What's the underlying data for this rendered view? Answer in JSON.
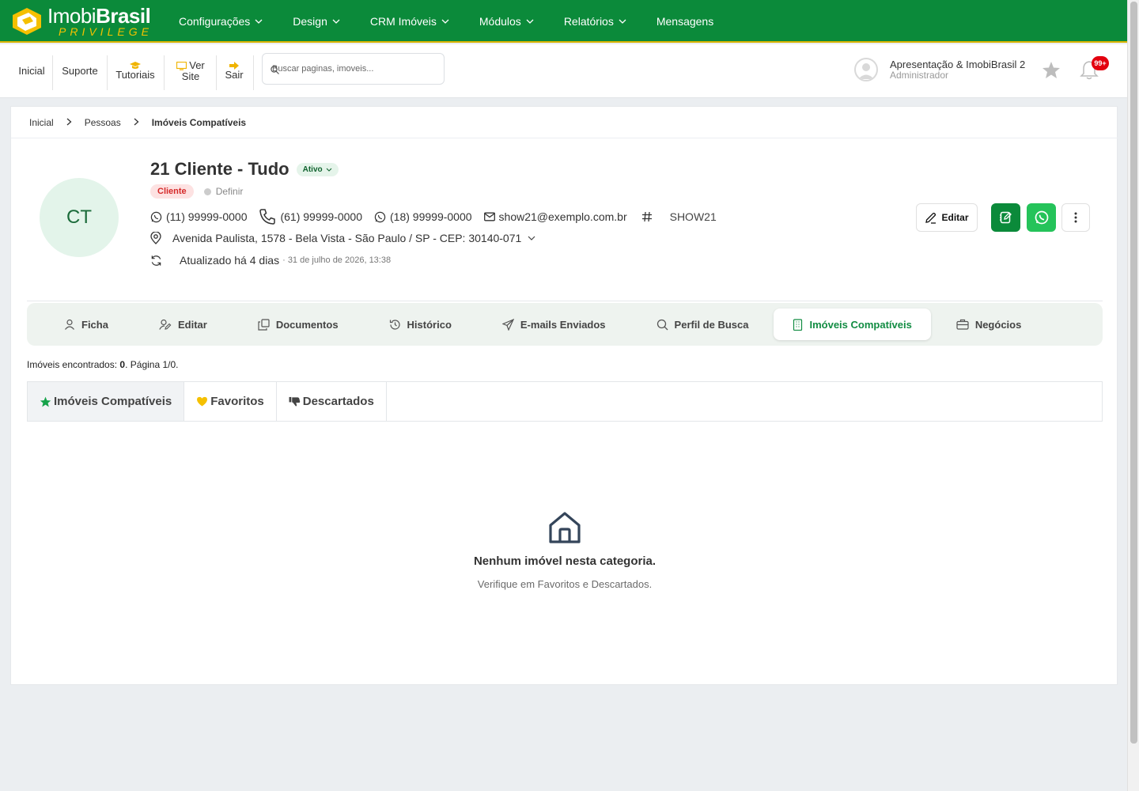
{
  "logo": {
    "brand_light": "Imobi",
    "brand_bold": "Brasil",
    "tagline": "PRIVILEGE"
  },
  "mainnav": [
    {
      "label": "Configurações",
      "dropdown": true
    },
    {
      "label": "Design",
      "dropdown": true
    },
    {
      "label": "CRM Imóveis",
      "dropdown": true
    },
    {
      "label": "Módulos",
      "dropdown": true
    },
    {
      "label": "Relatórios",
      "dropdown": true
    },
    {
      "label": "Mensagens",
      "dropdown": false
    }
  ],
  "toolbar": {
    "inicial": "Inicial",
    "suporte": "Suporte",
    "tutoriais": "Tutoriais",
    "ver_site_1": "Ver",
    "ver_site_2": "Site",
    "sair": "Sair",
    "search_placeholder": "Buscar paginas, imoveis..."
  },
  "user": {
    "name": "Apresentação & ImobiBrasil 2",
    "role": "Administrador",
    "notifications": "99+"
  },
  "breadcrumb": {
    "items": [
      "Inicial",
      "Pessoas"
    ],
    "current": "Imóveis Compatíveis"
  },
  "person": {
    "initials": "CT",
    "name": "21 Cliente - Tudo",
    "status": "Ativo",
    "type_tag": "Cliente",
    "define_label": "Definir",
    "phone_whatsapp_1": "(11) 99999-0000",
    "phone": "(61) 99999-0000",
    "phone_whatsapp_2": "(18) 99999-0000",
    "email": "show21@exemplo.com.br",
    "code": "SHOW21",
    "address": "Avenida Paulista, 1578 - Bela Vista - São Paulo / SP - CEP: 30140-071",
    "updated": "Atualizado há 4 dias",
    "updated_at": "· 31 de julho de 2026, 13:38"
  },
  "actions": {
    "edit_label": "Editar"
  },
  "tabs": [
    {
      "label": "Ficha",
      "icon": "user-icon"
    },
    {
      "label": "Editar",
      "icon": "user-edit-icon"
    },
    {
      "label": "Documentos",
      "icon": "documents-icon"
    },
    {
      "label": "Histórico",
      "icon": "history-icon"
    },
    {
      "label": "E-mails Enviados",
      "icon": "send-icon"
    },
    {
      "label": "Perfil de Busca",
      "icon": "search-icon"
    },
    {
      "label": "Imóveis Compatíveis",
      "icon": "building-icon",
      "active": true
    },
    {
      "label": "Negócios",
      "icon": "briefcase-icon"
    }
  ],
  "results": {
    "prefix": "Imóveis encontrados: ",
    "count": "0",
    "suffix": ". Página 1/0."
  },
  "subtabs": [
    {
      "label": "Imóveis Compatíveis",
      "icon": "star-icon",
      "color": "#16a34a"
    },
    {
      "label": "Favoritos",
      "icon": "heart-icon",
      "color": "#f5c000"
    },
    {
      "label": "Descartados",
      "icon": "thumbs-down-icon",
      "color": "#444444"
    }
  ],
  "empty": {
    "title": "Nenhum imóvel nesta categoria.",
    "subtitle": "Verifique em Favoritos e Descartados."
  },
  "colors": {
    "brand_green": "#0b8a3a",
    "accent_gold": "#d8b400",
    "whatsapp": "#25c35a",
    "active_tab": "#118c42"
  }
}
